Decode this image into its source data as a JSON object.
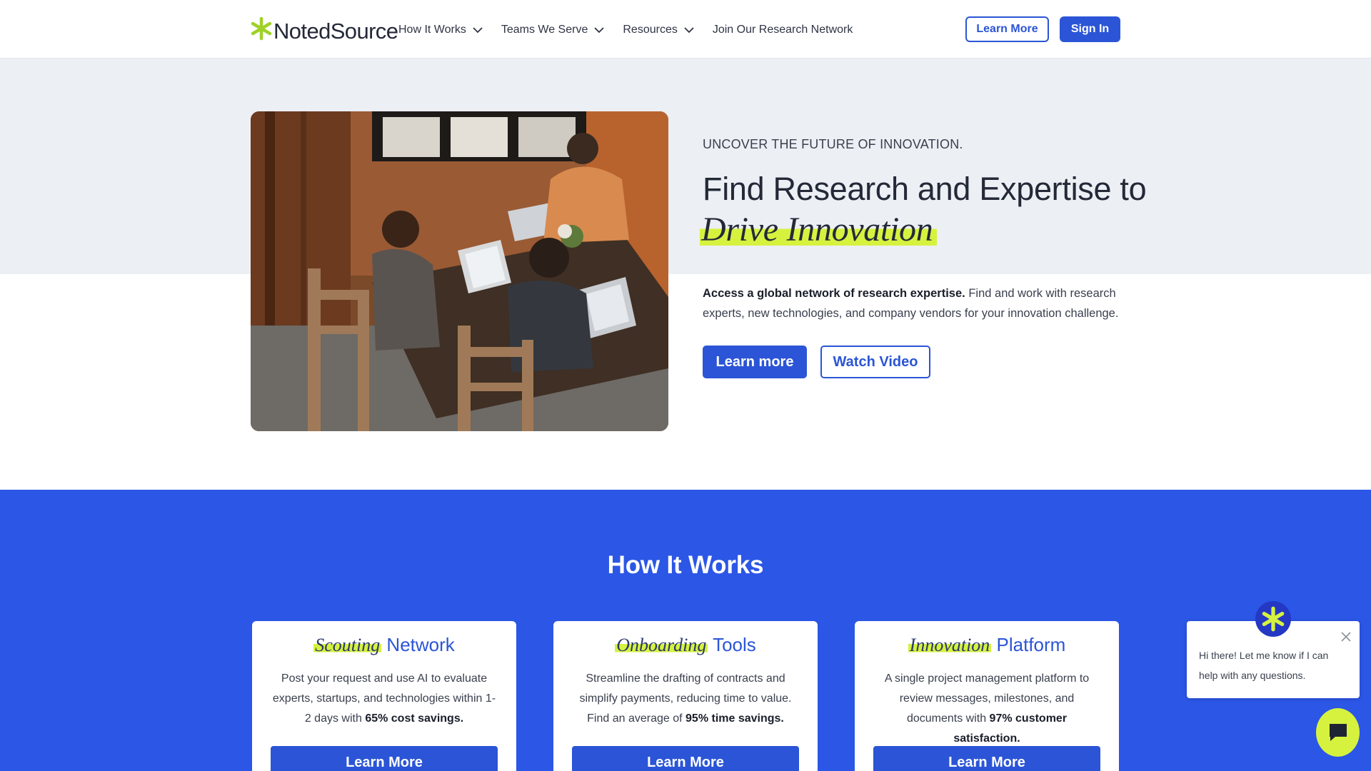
{
  "header": {
    "brand": "NotedSource",
    "nav": [
      {
        "label": "How It Works",
        "has_dropdown": true
      },
      {
        "label": "Teams We Serve",
        "has_dropdown": true
      },
      {
        "label": "Resources",
        "has_dropdown": true
      },
      {
        "label": "Join Our Research Network",
        "has_dropdown": false
      }
    ],
    "learn_more": "Learn More",
    "sign_in": "Sign In"
  },
  "hero": {
    "eyebrow": "UNCOVER THE FUTURE OF INNOVATION.",
    "headline_line1": "Find Research and Expertise to",
    "headline_emphasis": "Drive Innovation",
    "desc_bold": "Access a global network of research expertise.",
    "desc_rest": " Find and work with research experts, new technologies, and company vendors for your innovation challenge.",
    "learn_more": "Learn more",
    "watch_video": "Watch Video"
  },
  "how_it_works": {
    "title": "How It Works",
    "cards": [
      {
        "title_em": "Scouting",
        "title_rest": " Network",
        "desc_pre": "Post your request and use AI to evaluate experts, startups, and technologies within 1-2 days with ",
        "desc_bold": "65% cost savings.",
        "button": "Learn More"
      },
      {
        "title_em": "Onboarding",
        "title_rest": " Tools",
        "desc_pre": "Streamline the drafting of contracts and simplify payments, reducing time to value. Find an average of ",
        "desc_bold": "95% time savings.",
        "button": "Learn More"
      },
      {
        "title_em": "Innovation",
        "title_rest": " Platform",
        "desc_pre": "A single project management platform to review messages, milestones, and documents with ",
        "desc_bold": "97% customer satisfaction.",
        "button": "Learn More"
      }
    ]
  },
  "chat": {
    "message": "Hi there! Let me know if I can help with any questions."
  },
  "colors": {
    "primary_blue": "#2b55d6",
    "section_blue": "#2b56e6",
    "highlight_lime": "#d6f23f",
    "hero_bg": "#eceff4"
  },
  "icons": [
    "logo-star-icon",
    "chevron-down-icon",
    "close-icon",
    "chat-icon",
    "assistant-avatar-icon"
  ]
}
